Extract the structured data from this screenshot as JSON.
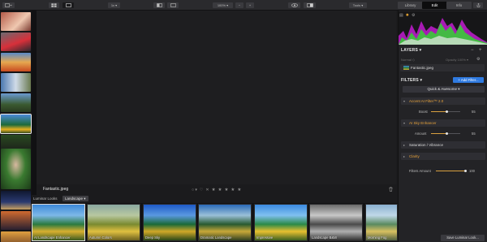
{
  "toolbar": {
    "zoom_fit": "1x",
    "zoom_percent": "100%",
    "zoom_out": "−",
    "zoom_in": "+",
    "tools_label": "Tools",
    "tabs": [
      {
        "label": "Library",
        "active": false
      },
      {
        "label": "Edit",
        "active": true
      },
      {
        "label": "Info",
        "active": false
      }
    ]
  },
  "canvas": {
    "file_name": "Fantastic.jpeg",
    "stars": [
      "★",
      "★",
      "★",
      "★",
      "★"
    ],
    "reject_mark": "✕",
    "flag_mark": "♡"
  },
  "looks": {
    "label": "Luminar Looks",
    "category": "Landscape",
    "items": [
      {
        "name": "AI Landscape Enhancer",
        "selected": true
      },
      {
        "name": "Autumn Colors",
        "selected": false
      },
      {
        "name": "Deep Sky",
        "selected": false
      },
      {
        "name": "Dramatic Landscape",
        "selected": false
      },
      {
        "name": "Impressive",
        "selected": false
      },
      {
        "name": "Landscape B&W",
        "selected": false
      },
      {
        "name": "Morning Fog",
        "selected": false
      }
    ]
  },
  "panel": {
    "layers_title": "LAYERS ▾",
    "normal_label": "Normal ◇",
    "opacity_label": "Opacity 100% ▾",
    "layer_name": "Fantastic.jpeg",
    "filters_title": "FILTERS ▾",
    "add_filter": "+ Add Filter...",
    "quick_awesome": "Quick & Awesome ▾",
    "filters": [
      {
        "name": "Accent AI Filter™ 2.0",
        "color": "orange",
        "slider": {
          "label": "Boost",
          "value": 55
        }
      },
      {
        "name": "AI Sky Enhancer",
        "color": "orange",
        "slider": {
          "label": "Amount",
          "value": 55
        }
      },
      {
        "name": "Saturation / Vibrance",
        "color": "white"
      },
      {
        "name": "Clarity",
        "color": "orange"
      }
    ],
    "filters_amount": {
      "label": "Filters Amount",
      "value": 100
    },
    "save_look": "Save Luminar Look..."
  },
  "colors": {
    "accent_blue": "#2f7ae0",
    "filter_orange": "#e8a33a",
    "histogram_green": "#3ec23e",
    "histogram_magenta": "#c11bd0"
  }
}
